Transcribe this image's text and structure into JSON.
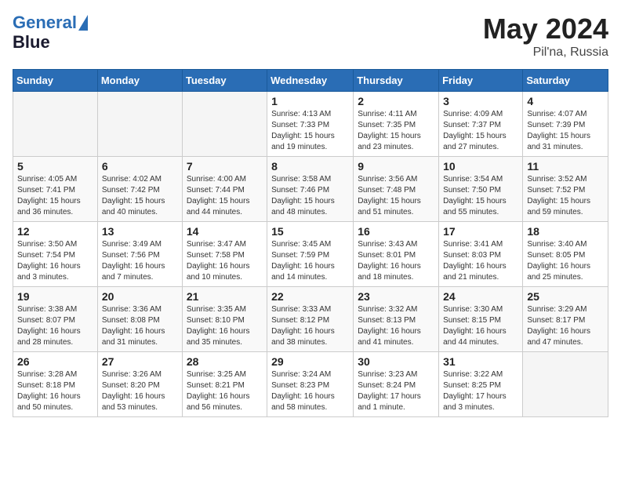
{
  "logo": {
    "line1": "General",
    "line2": "Blue"
  },
  "title": "May 2024",
  "location": "Pil'na, Russia",
  "weekdays": [
    "Sunday",
    "Monday",
    "Tuesday",
    "Wednesday",
    "Thursday",
    "Friday",
    "Saturday"
  ],
  "weeks": [
    [
      {
        "day": "",
        "info": ""
      },
      {
        "day": "",
        "info": ""
      },
      {
        "day": "",
        "info": ""
      },
      {
        "day": "1",
        "info": "Sunrise: 4:13 AM\nSunset: 7:33 PM\nDaylight: 15 hours\nand 19 minutes."
      },
      {
        "day": "2",
        "info": "Sunrise: 4:11 AM\nSunset: 7:35 PM\nDaylight: 15 hours\nand 23 minutes."
      },
      {
        "day": "3",
        "info": "Sunrise: 4:09 AM\nSunset: 7:37 PM\nDaylight: 15 hours\nand 27 minutes."
      },
      {
        "day": "4",
        "info": "Sunrise: 4:07 AM\nSunset: 7:39 PM\nDaylight: 15 hours\nand 31 minutes."
      }
    ],
    [
      {
        "day": "5",
        "info": "Sunrise: 4:05 AM\nSunset: 7:41 PM\nDaylight: 15 hours\nand 36 minutes."
      },
      {
        "day": "6",
        "info": "Sunrise: 4:02 AM\nSunset: 7:42 PM\nDaylight: 15 hours\nand 40 minutes."
      },
      {
        "day": "7",
        "info": "Sunrise: 4:00 AM\nSunset: 7:44 PM\nDaylight: 15 hours\nand 44 minutes."
      },
      {
        "day": "8",
        "info": "Sunrise: 3:58 AM\nSunset: 7:46 PM\nDaylight: 15 hours\nand 48 minutes."
      },
      {
        "day": "9",
        "info": "Sunrise: 3:56 AM\nSunset: 7:48 PM\nDaylight: 15 hours\nand 51 minutes."
      },
      {
        "day": "10",
        "info": "Sunrise: 3:54 AM\nSunset: 7:50 PM\nDaylight: 15 hours\nand 55 minutes."
      },
      {
        "day": "11",
        "info": "Sunrise: 3:52 AM\nSunset: 7:52 PM\nDaylight: 15 hours\nand 59 minutes."
      }
    ],
    [
      {
        "day": "12",
        "info": "Sunrise: 3:50 AM\nSunset: 7:54 PM\nDaylight: 16 hours\nand 3 minutes."
      },
      {
        "day": "13",
        "info": "Sunrise: 3:49 AM\nSunset: 7:56 PM\nDaylight: 16 hours\nand 7 minutes."
      },
      {
        "day": "14",
        "info": "Sunrise: 3:47 AM\nSunset: 7:58 PM\nDaylight: 16 hours\nand 10 minutes."
      },
      {
        "day": "15",
        "info": "Sunrise: 3:45 AM\nSunset: 7:59 PM\nDaylight: 16 hours\nand 14 minutes."
      },
      {
        "day": "16",
        "info": "Sunrise: 3:43 AM\nSunset: 8:01 PM\nDaylight: 16 hours\nand 18 minutes."
      },
      {
        "day": "17",
        "info": "Sunrise: 3:41 AM\nSunset: 8:03 PM\nDaylight: 16 hours\nand 21 minutes."
      },
      {
        "day": "18",
        "info": "Sunrise: 3:40 AM\nSunset: 8:05 PM\nDaylight: 16 hours\nand 25 minutes."
      }
    ],
    [
      {
        "day": "19",
        "info": "Sunrise: 3:38 AM\nSunset: 8:07 PM\nDaylight: 16 hours\nand 28 minutes."
      },
      {
        "day": "20",
        "info": "Sunrise: 3:36 AM\nSunset: 8:08 PM\nDaylight: 16 hours\nand 31 minutes."
      },
      {
        "day": "21",
        "info": "Sunrise: 3:35 AM\nSunset: 8:10 PM\nDaylight: 16 hours\nand 35 minutes."
      },
      {
        "day": "22",
        "info": "Sunrise: 3:33 AM\nSunset: 8:12 PM\nDaylight: 16 hours\nand 38 minutes."
      },
      {
        "day": "23",
        "info": "Sunrise: 3:32 AM\nSunset: 8:13 PM\nDaylight: 16 hours\nand 41 minutes."
      },
      {
        "day": "24",
        "info": "Sunrise: 3:30 AM\nSunset: 8:15 PM\nDaylight: 16 hours\nand 44 minutes."
      },
      {
        "day": "25",
        "info": "Sunrise: 3:29 AM\nSunset: 8:17 PM\nDaylight: 16 hours\nand 47 minutes."
      }
    ],
    [
      {
        "day": "26",
        "info": "Sunrise: 3:28 AM\nSunset: 8:18 PM\nDaylight: 16 hours\nand 50 minutes."
      },
      {
        "day": "27",
        "info": "Sunrise: 3:26 AM\nSunset: 8:20 PM\nDaylight: 16 hours\nand 53 minutes."
      },
      {
        "day": "28",
        "info": "Sunrise: 3:25 AM\nSunset: 8:21 PM\nDaylight: 16 hours\nand 56 minutes."
      },
      {
        "day": "29",
        "info": "Sunrise: 3:24 AM\nSunset: 8:23 PM\nDaylight: 16 hours\nand 58 minutes."
      },
      {
        "day": "30",
        "info": "Sunrise: 3:23 AM\nSunset: 8:24 PM\nDaylight: 17 hours\nand 1 minute."
      },
      {
        "day": "31",
        "info": "Sunrise: 3:22 AM\nSunset: 8:25 PM\nDaylight: 17 hours\nand 3 minutes."
      },
      {
        "day": "",
        "info": ""
      }
    ]
  ]
}
